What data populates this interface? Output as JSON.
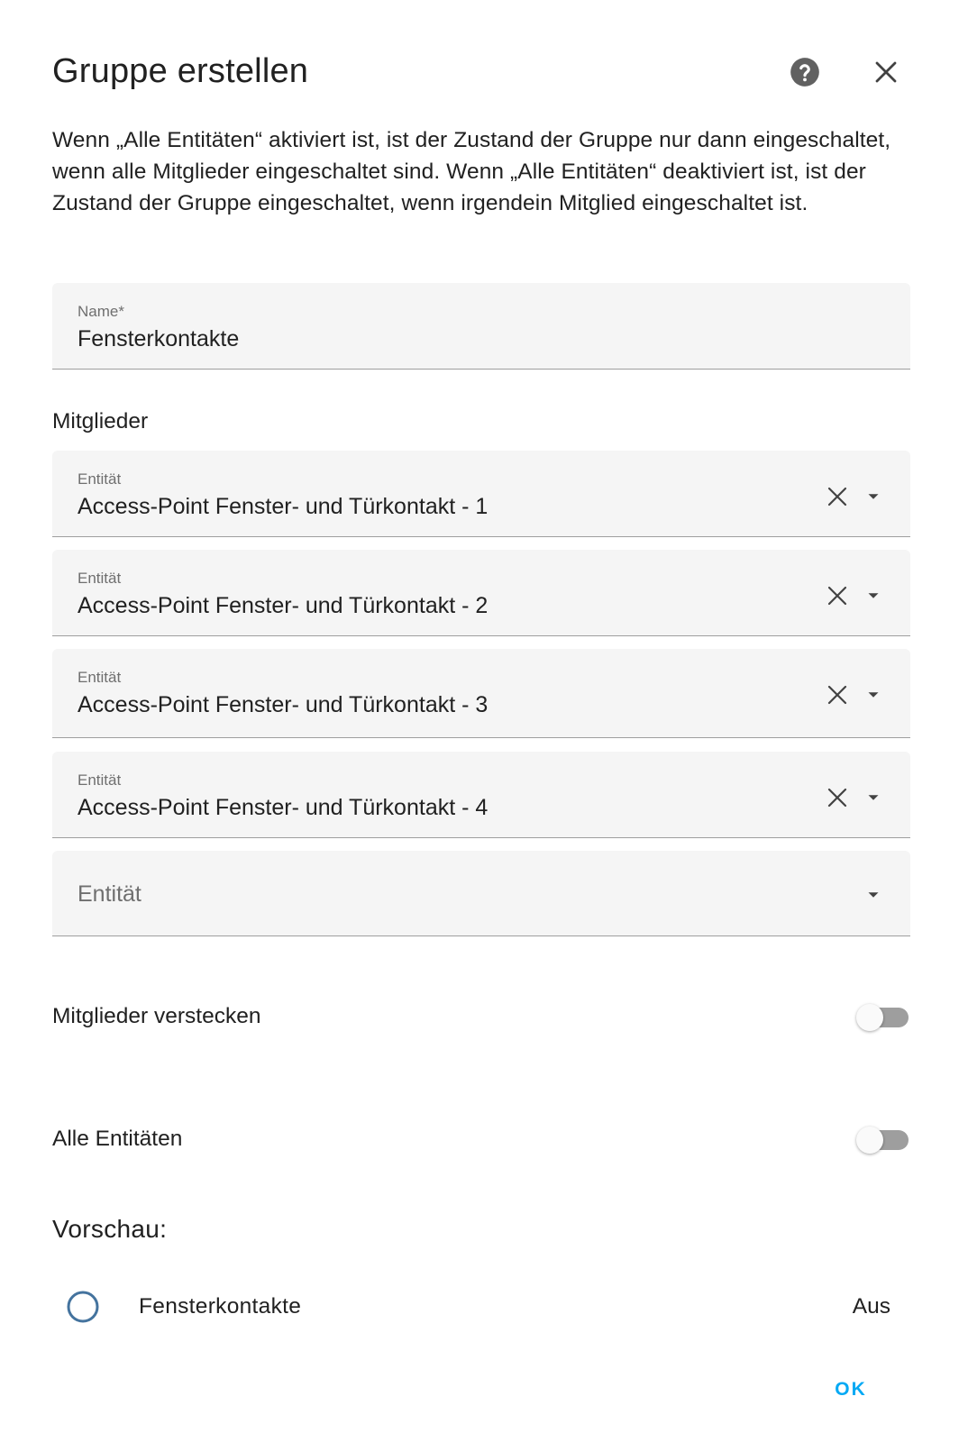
{
  "dialog": {
    "title": "Gruppe erstellen",
    "description": "Wenn „Alle Entitäten“ aktiviert ist, ist der Zustand der Gruppe nur dann eingeschaltet, wenn alle Mitglieder eingeschaltet sind. Wenn „Alle Entitäten“ deaktiviert ist, ist der Zustand der Gruppe eingeschaltet, wenn irgendein Mitglied eingeschaltet ist."
  },
  "name_field": {
    "label": "Name*",
    "value": "Fensterkontakte"
  },
  "members": {
    "label": "Mitglieder",
    "entities": [
      {
        "label": "Entität",
        "value": "Access-Point Fenster- und Türkontakt - 1"
      },
      {
        "label": "Entität",
        "value": "Access-Point Fenster- und Türkontakt - 2"
      },
      {
        "label": "Entität",
        "value": "Access-Point Fenster- und Türkontakt - 3"
      },
      {
        "label": "Entität",
        "value": "Access-Point Fenster- und Türkontakt - 4"
      }
    ],
    "empty_entity_label": "Entität"
  },
  "toggles": {
    "hide_members": {
      "label": "Mitglieder verstecken",
      "checked": false
    },
    "all_entities": {
      "label": "Alle Entitäten",
      "checked": false
    }
  },
  "preview": {
    "title": "Vorschau:",
    "name": "Fensterkontakte",
    "state": "Aus"
  },
  "actions": {
    "ok_label": "OK"
  },
  "icons": {
    "help": "help-circle-icon",
    "close": "close-icon",
    "clear": "clear-icon",
    "dropdown": "menu-down-icon",
    "preview": "circle-outline-icon"
  },
  "colors": {
    "accent": "#03a9f4",
    "preview_icon": "#44739e"
  }
}
